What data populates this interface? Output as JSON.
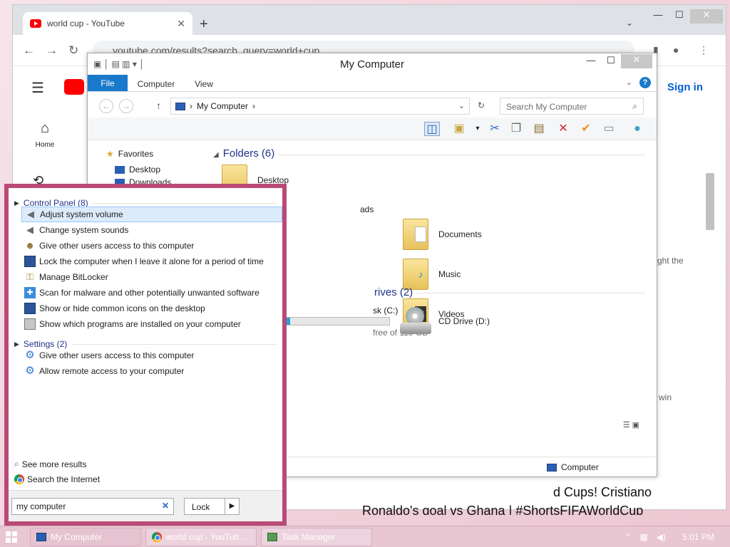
{
  "chrome": {
    "tab_title": "world cup - YouTube",
    "url": "youtube.com/results?search_query=world+cup",
    "sign_in": "Sign in",
    "sidebar_home": "Home",
    "frag_right1": "ght the",
    "frag_right2": "win",
    "result_line1": "d Cups! Cristiano",
    "result_line2": "Ronaldo's goal vs Ghana | #ShortsFIFAWorldCup"
  },
  "explorer": {
    "title": "My Computer",
    "ribbon_tabs": [
      "File",
      "Computer",
      "View"
    ],
    "address": "My Computer",
    "search_placeholder": "Search My Computer",
    "nav": {
      "favorites": "Favorites",
      "desktop": "Desktop",
      "downloads": "Downloads"
    },
    "folders_header": "Folders (6)",
    "folders": {
      "desktop": "Desktop",
      "downloads_frag": "ads",
      "documents": "Documents",
      "music": "Music",
      "videos": "Videos"
    },
    "drives_header_frag": "rives (2)",
    "local_disk_frag": "sk (C:)",
    "local_disk_free_frag": "free of 119 GB",
    "local_disk_used_fraction": 0.05,
    "cd_drive": "CD Drive (D:)",
    "status_label": "Computer"
  },
  "start_search": {
    "control_panel_header": "Control Panel (8)",
    "control_panel_items": [
      "Adjust system volume",
      "Change system sounds",
      "Give other users access to this computer",
      "Lock the computer when I leave it alone for a period of time",
      "Manage BitLocker",
      "Scan for malware and other potentially unwanted software",
      "Show or hide common icons on the desktop",
      "Show which programs are installed on your computer"
    ],
    "settings_header": "Settings (2)",
    "settings_items": [
      "Give other users access to this computer",
      "Allow remote access to your computer"
    ],
    "see_more": "See more results",
    "search_internet": "Search the Internet",
    "query": "my computer",
    "lock_label": "Lock"
  },
  "taskbar": {
    "tasks": [
      "My Computer",
      "world cup - YouTub...",
      "Task Manager"
    ],
    "clock": "5:01 PM"
  },
  "colors": {
    "accent": "#1979ca",
    "start_panel_border": "#b94a78",
    "youtube_red": "#ff0000"
  }
}
